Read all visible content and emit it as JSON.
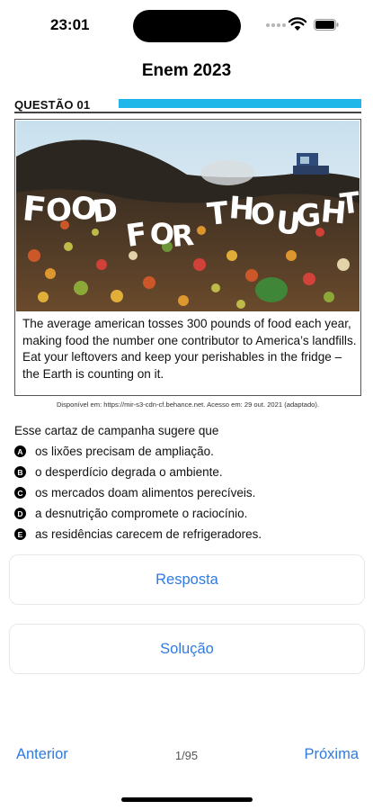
{
  "status_bar": {
    "time": "23:01"
  },
  "nav": {
    "title": "Enem 2023"
  },
  "question": {
    "label": "QUESTÃO 01",
    "accent_color": "#1fb6ea",
    "poster": {
      "headline": "FOOD FOR THOUGHT",
      "image_subject": "photo of a landfill covered in discarded fruit and vegetables with a bulldozer in the background",
      "body": "The average american tosses 300 pounds of food each year, making food the number one contributor to America’s landfills. Eat your leftovers and keep your perishables in the fridge – the Earth is counting on it."
    },
    "source_caption": "Disponível em: https://mir-s3-cdn-cf.behance.net. Acesso em: 29 out. 2021 (adaptado).",
    "statement": "Esse cartaz de campanha sugere que",
    "options": [
      {
        "letter": "A",
        "text": "os lixões precisam de ampliação."
      },
      {
        "letter": "B",
        "text": "o desperdício degrada o ambiente."
      },
      {
        "letter": "C",
        "text": "os mercados doam alimentos perecíveis."
      },
      {
        "letter": "D",
        "text": "a desnutrição compromete o raciocínio."
      },
      {
        "letter": "E",
        "text": "as residências carecem de refrigeradores."
      }
    ]
  },
  "buttons": {
    "answer": "Resposta",
    "solution": "Solução"
  },
  "footer": {
    "previous": "Anterior",
    "page": "1/95",
    "next": "Próxima"
  },
  "colors": {
    "link": "#2f7be0"
  }
}
